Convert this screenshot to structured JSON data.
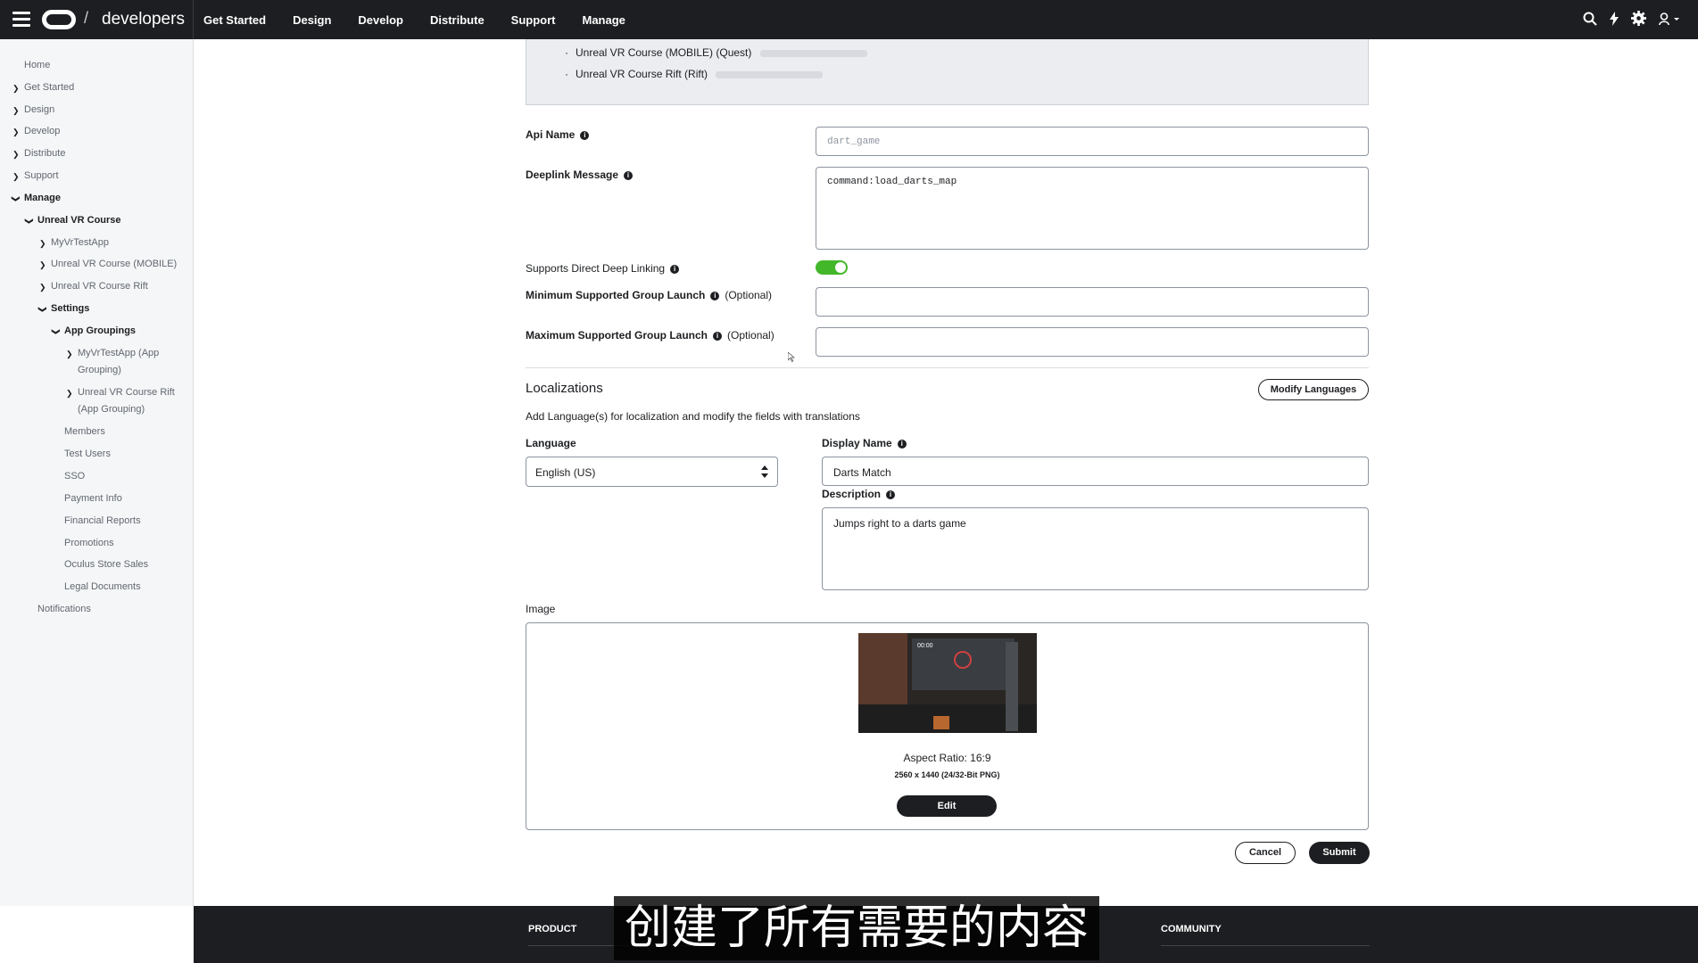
{
  "header": {
    "brand": "developers",
    "nav": [
      "Get Started",
      "Design",
      "Develop",
      "Distribute",
      "Support",
      "Manage"
    ]
  },
  "sidebar": {
    "home": "Home",
    "get_started": "Get Started",
    "design": "Design",
    "develop": "Develop",
    "distribute": "Distribute",
    "support": "Support",
    "manage": "Manage",
    "unreal_vr_course": "Unreal VR Course",
    "myvrtestapp": "MyVrTestApp",
    "unreal_mobile": "Unreal VR Course (MOBILE)",
    "unreal_rift": "Unreal VR Course Rift",
    "settings": "Settings",
    "app_groupings": "App Groupings",
    "grouping1_line1": "MyVrTestApp (App",
    "grouping1_line2": "Grouping)",
    "grouping2_line1": "Unreal VR Course Rift",
    "grouping2_line2": "(App Grouping)",
    "members": "Members",
    "test_users": "Test Users",
    "sso": "SSO",
    "payment_info": "Payment Info",
    "financial_reports": "Financial Reports",
    "promotions": "Promotions",
    "oculus_store_sales": "Oculus Store Sales",
    "legal_documents": "Legal Documents",
    "notifications": "Notifications"
  },
  "apps_box": {
    "bullet1": "Unreal VR Course (MOBILE) (Quest)",
    "bullet2": "Unreal VR Course Rift (Rift)"
  },
  "form": {
    "api_name_label": "Api Name",
    "api_name_placeholder": "dart_game",
    "deeplink_label": "Deeplink Message",
    "deeplink_value": "command:load_darts_map",
    "direct_deep_linking_label": "Supports Direct Deep Linking",
    "direct_deep_linking_on": true,
    "min_group_label": "Minimum Supported Group Launch",
    "max_group_label": "Maximum Supported Group Launch",
    "optional": "(Optional)",
    "min_group_value": "",
    "max_group_value": ""
  },
  "localizations": {
    "title": "Localizations",
    "modify_button": "Modify Languages",
    "description": "Add Language(s) for localization and modify the fields with translations",
    "language_label": "Language",
    "language_value": "English (US)",
    "display_name_label": "Display Name",
    "display_name_value": "Darts Match",
    "description_label": "Description",
    "description_value": "Jumps right to a darts game"
  },
  "image": {
    "label": "Image",
    "preview_timer": "00:00",
    "aspect_ratio": "Aspect Ratio: 16:9",
    "dimensions": "2560 x 1440 (24/32-Bit PNG)",
    "edit_button": "Edit"
  },
  "actions": {
    "cancel": "Cancel",
    "submit": "Submit"
  },
  "footer": {
    "product": "PRODUCT",
    "community": "COMMUNITY"
  },
  "subtitle": "创建了所有需要的内容",
  "colors": {
    "topbar": "#1c1e21",
    "toggle_on": "#42b72a",
    "sidebar_bg": "#f5f6f7"
  }
}
